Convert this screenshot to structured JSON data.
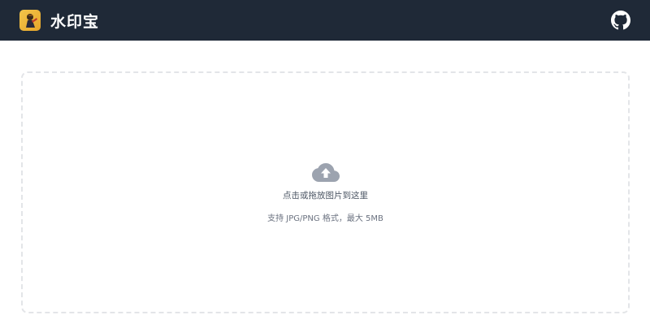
{
  "header": {
    "app_title": "水印宝",
    "logo_icon": "app-logo-icon",
    "github_icon": "github-icon"
  },
  "dropzone": {
    "upload_icon": "cloud-upload-icon",
    "primary_text": "点击或拖放图片到这里",
    "secondary_text": "支持 JPG/PNG 格式，最大 5MB"
  },
  "colors": {
    "header_bg": "#1f2937",
    "border": "#e3e5e8",
    "icon": "#9ca3af"
  }
}
